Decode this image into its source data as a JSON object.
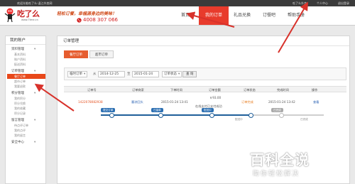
{
  "topbar": {
    "welcome": "欢迎光临吃了么-温江外卖网",
    "links": [
      "吃了么外卖",
      "个人中心",
      "退出登录"
    ]
  },
  "header": {
    "logo_text": "吃了么",
    "logo_url": "www.7tme.cn",
    "slogan": "轻松订餐，幸福源身边的美味！",
    "hotline": "4008 307 066",
    "nav": [
      "首页",
      "我的订单",
      "礼品兑换",
      "订餐吧",
      "帮助手册"
    ],
    "active_nav": "我的订单"
  },
  "sidebar": {
    "title": "我的账户",
    "groups": [
      {
        "label": "资料管理",
        "items": [
          "基本资料",
          "账户资料",
          "配送资料"
        ]
      },
      {
        "label": "订单管理",
        "items": [
          "餐厅订单",
          "超市订单",
          "我要退款"
        ],
        "active": "餐厅订单"
      },
      {
        "label": "积分管理",
        "items": [
          "我的积分",
          "积分兑换",
          "我的收藏",
          "积分记录"
        ]
      },
      {
        "label": "留言管理",
        "items": [
          "待点评订单",
          "我的点评",
          "我的留言"
        ]
      },
      {
        "label": "安全中心",
        "items": []
      }
    ]
  },
  "main": {
    "title": "订单管理",
    "tabs": [
      "餐厅订单",
      "超市订单"
    ],
    "active_tab": "餐厅订单",
    "filter": {
      "date_type": "临时订单",
      "from_label": "从",
      "from_date": "2014-12-25",
      "to_label": "至",
      "to_date": "2015-01-24",
      "status": "订单状态",
      "query_button": "查 询"
    },
    "columns": [
      "订单号",
      "订单商家",
      "下单时间",
      "订单金额",
      "订单状态",
      "完成时间",
      "操作"
    ],
    "order": {
      "order_no": "1422078082938",
      "merchant": "塞凉回头",
      "order_time": "2015-01-24 13:41",
      "amount": "￥93.00",
      "pay_info": "在线支付已支付成功",
      "status": "订单完成",
      "finish_time": "2015-01-24 13:42",
      "action": "查看",
      "flow": {
        "steps": [
          "提交订单",
          "已接单",
          "配送中",
          "已完成"
        ],
        "step_times": [
          "",
          "",
          "配送中",
          "已完成"
        ]
      }
    }
  },
  "watermark": {
    "title": "百科全说",
    "subtitle": "助你轻松解决"
  },
  "colors": {
    "accent": "#e83b2c",
    "tab_active": "#e65d2f",
    "link_blue": "#2a61b3",
    "flow_blue": "#1f5f9a",
    "status_orange": "#e77817"
  }
}
